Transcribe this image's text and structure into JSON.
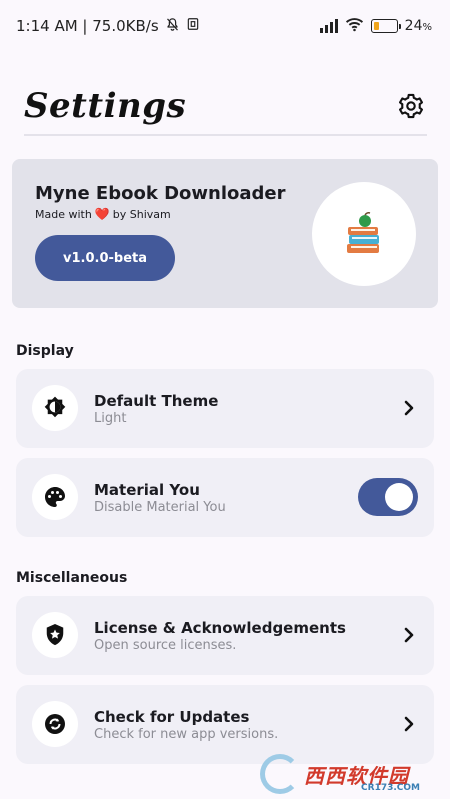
{
  "status_bar": {
    "time_speed": "1:14 AM | 75.0KB/s",
    "battery_percent": "24",
    "battery_level": 0.24,
    "icons": [
      "mute-bell-icon",
      "nfc-icon",
      "signal-icon",
      "wifi-icon",
      "battery-icon"
    ]
  },
  "header": {
    "title": "Settings",
    "gear_icon": "gear-icon"
  },
  "about": {
    "app_name": "Myne Ebook Downloader",
    "made_with_prefix": "Made with",
    "heart": "❤️",
    "made_with_suffix": "by Shivam",
    "version": "v1.0.0-beta",
    "logo_icon": "books-with-apple-icon"
  },
  "display": {
    "label": "Display",
    "items": [
      {
        "title": "Default Theme",
        "subtitle": "Light",
        "icon": "brightness-icon",
        "control": "chevron-right-icon"
      },
      {
        "title": "Material You",
        "subtitle": "Disable Material You",
        "icon": "palette-icon",
        "control": "toggle",
        "toggle_on": true
      }
    ]
  },
  "misc": {
    "label": "Miscellaneous",
    "items": [
      {
        "title": "License & Acknowledgements",
        "subtitle": "Open source licenses.",
        "icon": "shield-star-icon",
        "control": "chevron-right-icon"
      },
      {
        "title": "Check for Updates",
        "subtitle": "Check for new app versions.",
        "icon": "update-icon",
        "control": "chevron-right-icon"
      }
    ]
  },
  "watermark": {
    "text": "西西软件园",
    "site": "CR173.COM"
  },
  "colors": {
    "background": "#fbf8fd",
    "card": "#f0eff6",
    "about_card": "#e2e2ea",
    "accent": "#43599a",
    "subtitle": "#8c8c94"
  }
}
